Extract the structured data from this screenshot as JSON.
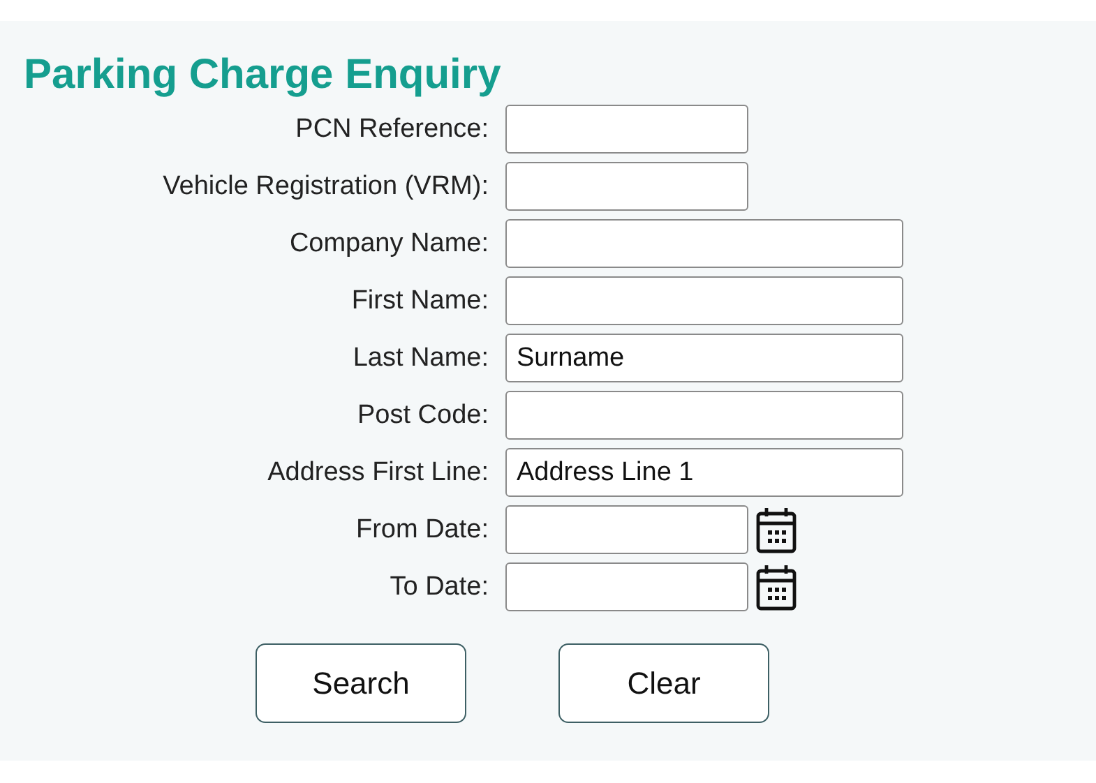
{
  "title": "Parking Charge Enquiry",
  "fields": [
    {
      "label": "PCN Reference:",
      "kind": "short"
    },
    {
      "label": "Vehicle Registration (VRM):",
      "kind": "short"
    },
    {
      "label": "Company Name:",
      "kind": "wide"
    },
    {
      "label": "First Name:",
      "kind": "wide"
    },
    {
      "label": "Last Name:",
      "kind": "wide",
      "value": "Surname"
    },
    {
      "label": "Post Code:",
      "kind": "wide"
    },
    {
      "label": "Address First Line:",
      "kind": "wide",
      "value": "Address Line 1"
    },
    {
      "label": "From Date:",
      "kind": "date"
    },
    {
      "label": "To Date:",
      "kind": "date"
    }
  ],
  "buttons": [
    "Search",
    "Clear"
  ]
}
